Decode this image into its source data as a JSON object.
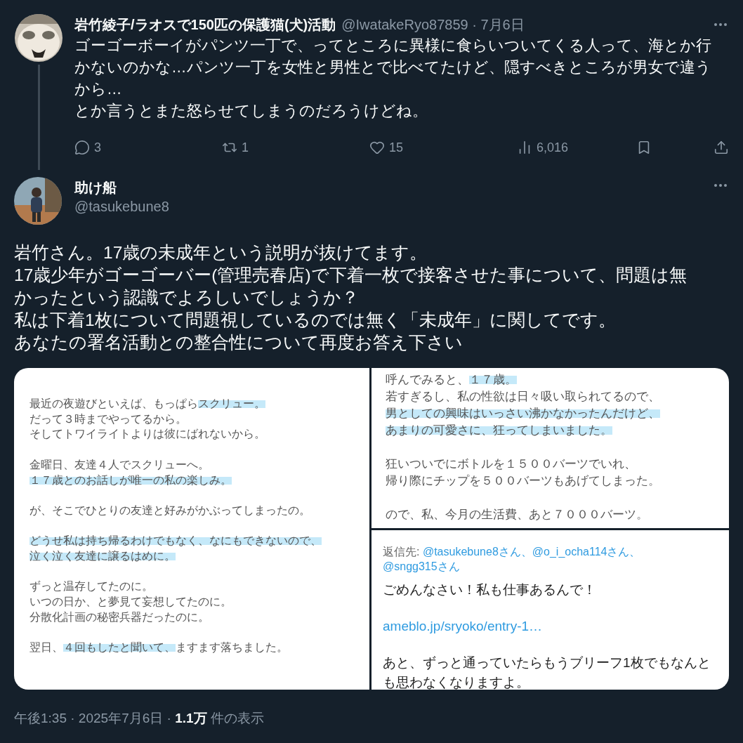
{
  "parent_tweet": {
    "name": "岩竹綾子/ラオスで150匹の保護猫(犬)活動",
    "handle_date": "@IwatakeRyo87859 · 7月6日",
    "text": [
      "ゴーゴーボーイがパンツ一丁で、ってところに異様に食らいついてくる人って、海とか行かないのかな…パンツ一丁を女性と男性とで比べてたけど、隠すべきところが男女で違うから…",
      "とか言うとまた怒らせてしまうのだろうけどね。"
    ],
    "actions": [
      {
        "kind": "reply",
        "count": "3"
      },
      {
        "kind": "repost",
        "count": "1"
      },
      {
        "kind": "like",
        "count": "15"
      },
      {
        "kind": "views",
        "count": "6,016"
      },
      {
        "kind": "bookmark"
      },
      {
        "kind": "share"
      }
    ]
  },
  "main_tweet": {
    "name": "助け船",
    "handle": "@tasukebune8",
    "text": [
      "岩竹さん。17歳の未成年という説明が抜けてます。",
      "17歳少年がゴーゴーバー(管理売春店)で下着一枚で接客させた事について、問題は無かったという認識でよろしいでしょうか？",
      "私は下着1枚について問題視しているのでは無く「未成年」に関してです。",
      "あなたの署名活動との整合性について再度お答え下さい"
    ],
    "media": [
      {
        "kind": "blog_excerpt",
        "paragraphs": [
          [
            [
              {
                "text": "最近の夜遊びといえば、もっぱら",
                "highlight": false
              },
              {
                "text": "スクリュー。",
                "highlight": true
              }
            ],
            [
              {
                "text": "だって３時までやってるから。",
                "highlight": false
              }
            ],
            [
              {
                "text": "そしてトワイライトよりは彼にばれないから。",
                "highlight": false
              }
            ]
          ],
          [
            [
              {
                "text": "金曜日、友達４人でスクリューへ。",
                "highlight": false
              }
            ],
            [
              {
                "text": "１７歳とのお話しが唯一の私の楽しみ。",
                "highlight": true
              }
            ]
          ],
          [
            [
              {
                "text": "が、そこでひとりの友達と好みがかぶってしまったの。",
                "highlight": false
              }
            ]
          ],
          [
            [
              {
                "text": "どうせ私は持ち帰るわけでもなく、なにもできないので、",
                "highlight": true
              }
            ],
            [
              {
                "text": "泣く泣く友達に譲るはめに。",
                "highlight": true
              }
            ]
          ],
          [
            [
              {
                "text": "ずっと温存してたのに。",
                "highlight": false
              }
            ],
            [
              {
                "text": "いつの日か、と夢見て妄想してたのに。",
                "highlight": false
              }
            ],
            [
              {
                "text": "分散化計画の秘密兵器だったのに。",
                "highlight": false
              }
            ]
          ],
          [
            [
              {
                "text": "翌日、",
                "highlight": false
              },
              {
                "text": "４回もしたと聞いて、",
                "highlight": true
              },
              {
                "text": "ますます落ちました。",
                "highlight": false
              }
            ]
          ]
        ]
      },
      {
        "kind": "blog_excerpt_cropped",
        "paragraphs": [
          [
            [
              {
                "text": "呼んでみると、",
                "highlight": false
              },
              {
                "text": "１７歳。",
                "highlight": true
              }
            ],
            [
              {
                "text": "若すぎるし、私の性欲は日々吸い取られてるので、",
                "highlight": false
              }
            ],
            [
              {
                "text": "男としての興味はいっさい沸かなかったんだけど、",
                "highlight": true
              }
            ],
            [
              {
                "text": "あまりの可愛さに、狂ってしまいました。",
                "highlight": true
              }
            ]
          ],
          [
            [
              {
                "text": "狂いついでにボトルを１５００バーツでいれ、",
                "highlight": false
              }
            ],
            [
              {
                "text": "帰り際にチップを５００バーツもあげてしまった。",
                "highlight": false
              }
            ]
          ],
          [
            [
              {
                "text": "ので、私、今月の生活費、あと７０００バーツ。",
                "highlight": false
              }
            ]
          ]
        ]
      },
      {
        "kind": "tweet_screenshot",
        "reply_label": "返信先:",
        "reply_handles": [
          "@tasukebune8さん、",
          "@o_i_ocha114さん、",
          "@sngg315さん"
        ],
        "blocks": [
          {
            "kind": "text",
            "text": "ごめんなさい！私も仕事あるんで！"
          },
          {
            "kind": "link",
            "text": "ameblo.jp/sryoko/entry-1…"
          },
          {
            "kind": "text",
            "text": "あと、ずっと通っていたらもうブリーフ1枚でもなんとも思わなくなりますよ。"
          }
        ]
      }
    ],
    "footer": "午後1:35 · 2025年7月6日 · **1.1万** 件の表示"
  }
}
